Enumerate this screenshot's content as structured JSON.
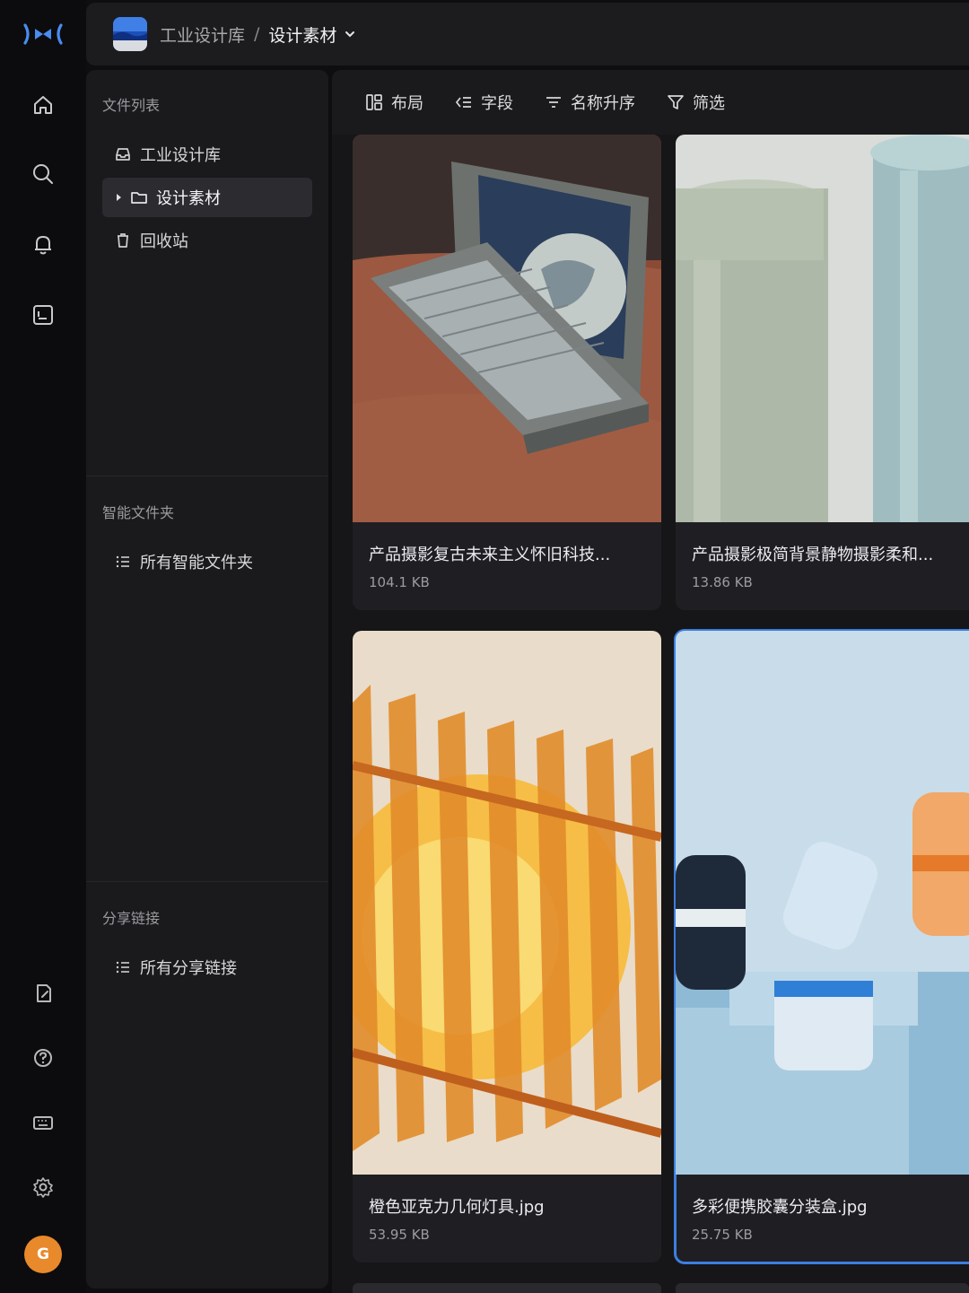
{
  "header": {
    "library": "工业设计库",
    "separator": "/",
    "current": "设计素材"
  },
  "rail": {
    "avatar_letter": "G",
    "accent": "#e8892b"
  },
  "panel": {
    "file_list_title": "文件列表",
    "items": [
      {
        "label": "工业设计库",
        "icon": "inbox-icon"
      },
      {
        "label": "设计素材",
        "icon": "folder-icon"
      },
      {
        "label": "回收站",
        "icon": "trash-icon"
      }
    ],
    "smart_title": "智能文件夹",
    "smart_item": "所有智能文件夹",
    "share_title": "分享链接",
    "share_item": "所有分享链接"
  },
  "toolbar": {
    "layout": "布局",
    "fields": "字段",
    "sort": "名称升序",
    "filter": "筛选"
  },
  "files": [
    {
      "name": "产品摄影复古未来主义怀旧科技...",
      "size": "104.1 KB"
    },
    {
      "name": "产品摄影极简背景静物摄影柔和...",
      "size": "13.86 KB"
    },
    {
      "name": "橙色亚克力几何灯具.jpg",
      "size": "53.95 KB"
    },
    {
      "name": "多彩便携胶囊分装盒.jpg",
      "size": "25.75 KB",
      "selected": true
    }
  ],
  "colors": {
    "selection": "#3d7fe0"
  }
}
